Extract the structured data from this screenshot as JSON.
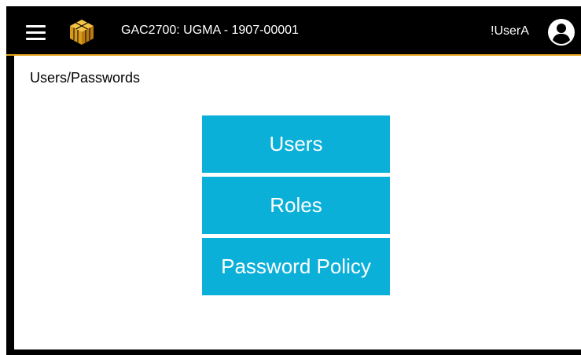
{
  "header": {
    "menu_icon": "hamburger-menu-icon",
    "logo_icon": "gold-cube-logo-icon",
    "title": "GAC2700: UGMA - 1907-00001",
    "user_name": "!UserA",
    "user_icon": "account-circle-icon",
    "accent_color": "#e3a21a"
  },
  "page": {
    "title": "Users/Passwords"
  },
  "buttons": {
    "users_label": "Users",
    "roles_label": "Roles",
    "password_policy_label": "Password Policy",
    "color": "#0bb0d9"
  }
}
